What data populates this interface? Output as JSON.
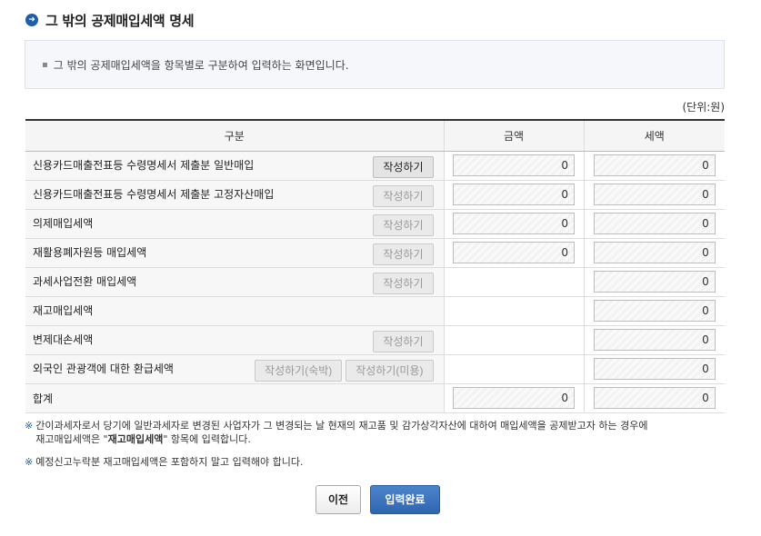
{
  "page": {
    "title": "그 밖의 공제매입세액 명세",
    "info": "그 밖의 공제매입세액을 항목별로 구분하여 입력하는 화면입니다.",
    "unit": "(단위:원)"
  },
  "table": {
    "headers": {
      "category": "구분",
      "amount": "금액",
      "tax": "세액"
    },
    "rows": [
      {
        "label": "신용카드매출전표등 수령명세서 제출분 일반매입",
        "button": "작성하기",
        "amount": "0",
        "tax": "0"
      },
      {
        "label": "신용카드매출전표등 수령명세서 제출분 고정자산매입",
        "button": "작성하기",
        "amount": "0",
        "tax": "0"
      },
      {
        "label": "의제매입세액",
        "button": "작성하기",
        "amount": "0",
        "tax": "0"
      },
      {
        "label": "재활용폐자원등 매입세액",
        "button": "작성하기",
        "amount": "0",
        "tax": "0"
      },
      {
        "label": "과세사업전환 매입세액",
        "button": "작성하기",
        "tax": "0"
      },
      {
        "label": "재고매입세액",
        "tax": "0"
      },
      {
        "label": "변제대손세액",
        "button": "작성하기",
        "tax": "0"
      },
      {
        "label": "외국인 관광객에 대한 환급세액",
        "button_a": "작성하기(숙박)",
        "button_b": "작성하기(미용)",
        "tax": "0"
      }
    ],
    "total": {
      "label": "합계",
      "amount": "0",
      "tax": "0"
    }
  },
  "notes": {
    "mark": "※",
    "note1_a": "간이과세자로서 당기에 일반과세자로 변경된 사업자가 그 변경되는 날 현재의 재고품 및 감가상각자산에 대하여 매입세액을 공제받고자 하는 경우에",
    "note1_b1": "재고매입세액은 \"",
    "note1_hl": "재고매입세액",
    "note1_b2": "\" 항목에 입력합니다.",
    "note2": "예정신고누락분 재고매입세액은 포함하지 말고 입력해야 합니다."
  },
  "footer": {
    "prev": "이전",
    "done": "입력완료"
  },
  "colors": {
    "accent": "#1f5fa8",
    "primary_button": "#2d65b0"
  },
  "icons": {
    "title": "arrow-circle-icon"
  }
}
